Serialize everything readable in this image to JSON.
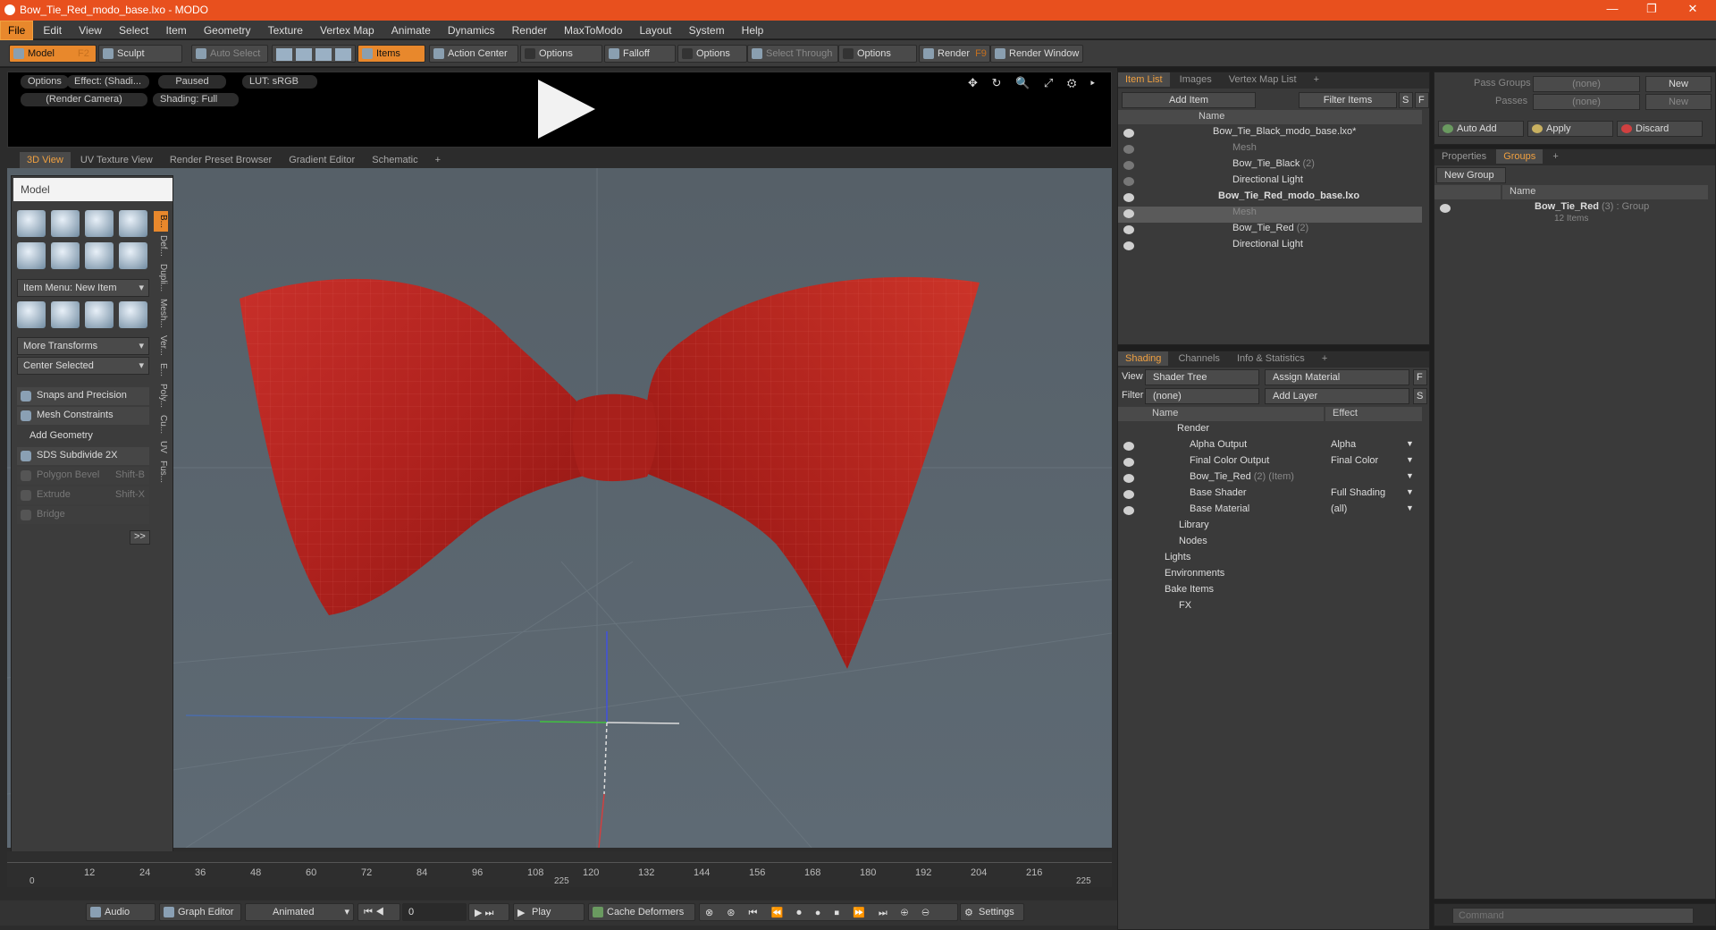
{
  "window": {
    "title": "Bow_Tie_Red_modo_base.lxo - MODO",
    "controls": [
      "—",
      "❐",
      "✕"
    ]
  },
  "menu": [
    "File",
    "Edit",
    "View",
    "Select",
    "Item",
    "Geometry",
    "Texture",
    "Vertex Map",
    "Animate",
    "Dynamics",
    "Render",
    "MaxToModo",
    "Layout",
    "System",
    "Help"
  ],
  "toolbar": {
    "model": "Model",
    "model_key": "F2",
    "sculpt": "Sculpt",
    "auto_select": "Auto Select",
    "items": "Items",
    "action_center": "Action Center",
    "options1": "Options",
    "falloff": "Falloff",
    "options2": "Options",
    "select_through": "Select Through",
    "options3": "Options",
    "render": "Render",
    "render_key": "F9",
    "render_window": "Render Window"
  },
  "render_preview": {
    "options": "Options",
    "effect": "Effect: (Shadi...",
    "paused": "Paused",
    "lut": "LUT: sRGB",
    "camera": "(Render Camera)",
    "shading": "Shading: Full",
    "icons": "✥ ↻ 🔍 ⤢ ⚙ ▸"
  },
  "viewport_tabs": [
    "3D View",
    "UV Texture View",
    "Render Preset Browser",
    "Gradient Editor",
    "Schematic",
    "+"
  ],
  "tool_panel": {
    "title": "Model",
    "item_menu": "Item Menu: New Item",
    "more_transforms": "More Transforms",
    "center_selected": "Center Selected",
    "snaps": "Snaps and Precision",
    "mesh_constraints": "Mesh Constraints",
    "add_geometry": "Add Geometry",
    "sds": "SDS Subdivide 2X",
    "polygon_bevel": "Polygon Bevel",
    "polygon_bevel_key": "Shift-B",
    "extrude": "Extrude",
    "extrude_key": "Shift-X",
    "bridge": "Bridge",
    "more": ">>",
    "side_tabs": [
      "B...",
      "Def...",
      "Dupli...",
      "Mesh...",
      "Ver...",
      "E...",
      "Poly...",
      "Cu...",
      "UV",
      "Fus..."
    ]
  },
  "timeline": {
    "ticks": [
      "0",
      "12",
      "24",
      "36",
      "48",
      "60",
      "72",
      "84",
      "96",
      "108",
      "120",
      "132",
      "144",
      "156",
      "168",
      "180",
      "192",
      "204",
      "216"
    ],
    "start": "0",
    "mid": "225",
    "end": "225"
  },
  "bottom_bar": {
    "audio": "Audio",
    "graph_editor": "Graph Editor",
    "animated": "Animated",
    "frame": "0",
    "play": "Play",
    "cache": "Cache Deformers",
    "settings": "Settings"
  },
  "item_list": {
    "tabs": [
      "Item List",
      "Images",
      "Vertex Map List",
      "+"
    ],
    "add_item": "Add Item",
    "filter_items": "Filter Items",
    "s": "S",
    "f": "F",
    "col_name": "Name",
    "rows": [
      {
        "label": "Bow_Tie_Black_modo_base.lxo*",
        "count": ""
      },
      {
        "label": "Mesh",
        "count": ""
      },
      {
        "label": "Bow_Tie_Black",
        "count": "(2)"
      },
      {
        "label": "Directional Light",
        "count": ""
      },
      {
        "label": "Bow_Tie_Red_modo_base.lxo",
        "count": ""
      },
      {
        "label": "Mesh",
        "count": ""
      },
      {
        "label": "Bow_Tie_Red",
        "count": "(2)"
      },
      {
        "label": "Directional Light",
        "count": ""
      }
    ]
  },
  "shading": {
    "tabs": [
      "Shading",
      "Channels",
      "Info & Statistics",
      "+"
    ],
    "view_label": "View",
    "view_value": "Shader Tree",
    "assign_material": "Assign Material",
    "f": "F",
    "filter_label": "Filter",
    "filter_value": "(none)",
    "add_layer": "Add Layer",
    "s": "S",
    "col_name": "Name",
    "col_effect": "Effect",
    "rows": [
      {
        "label": "Render",
        "extra": "",
        "effect": ""
      },
      {
        "label": "Alpha Output",
        "extra": "",
        "effect": "Alpha"
      },
      {
        "label": "Final Color Output",
        "extra": "",
        "effect": "Final Color"
      },
      {
        "label": "Bow_Tie_Red",
        "extra": "(2) (Item)",
        "effect": ""
      },
      {
        "label": "Base Shader",
        "extra": "",
        "effect": "Full Shading"
      },
      {
        "label": "Base Material",
        "extra": "",
        "effect": "(all)"
      },
      {
        "label": "Library",
        "extra": "",
        "effect": ""
      },
      {
        "label": "Nodes",
        "extra": "",
        "effect": ""
      },
      {
        "label": "Lights",
        "extra": "",
        "effect": ""
      },
      {
        "label": "Environments",
        "extra": "",
        "effect": ""
      },
      {
        "label": "Bake Items",
        "extra": "",
        "effect": ""
      },
      {
        "label": "FX",
        "extra": "",
        "effect": ""
      }
    ]
  },
  "pass_panel": {
    "pass_groups_label": "Pass Groups",
    "pass_groups_value": "(none)",
    "new1": "New",
    "passes_label": "Passes",
    "passes_value": "(none)",
    "new2": "New",
    "auto_add": "Auto Add",
    "apply": "Apply",
    "discard": "Discard"
  },
  "groups": {
    "tabs": [
      "Properties",
      "Groups",
      "+"
    ],
    "new_group": "New Group",
    "col_name": "Name",
    "group_name": "Bow_Tie_Red",
    "group_meta": "(3) : Group",
    "group_items": "12 Items"
  },
  "command": {
    "placeholder": "Command"
  }
}
